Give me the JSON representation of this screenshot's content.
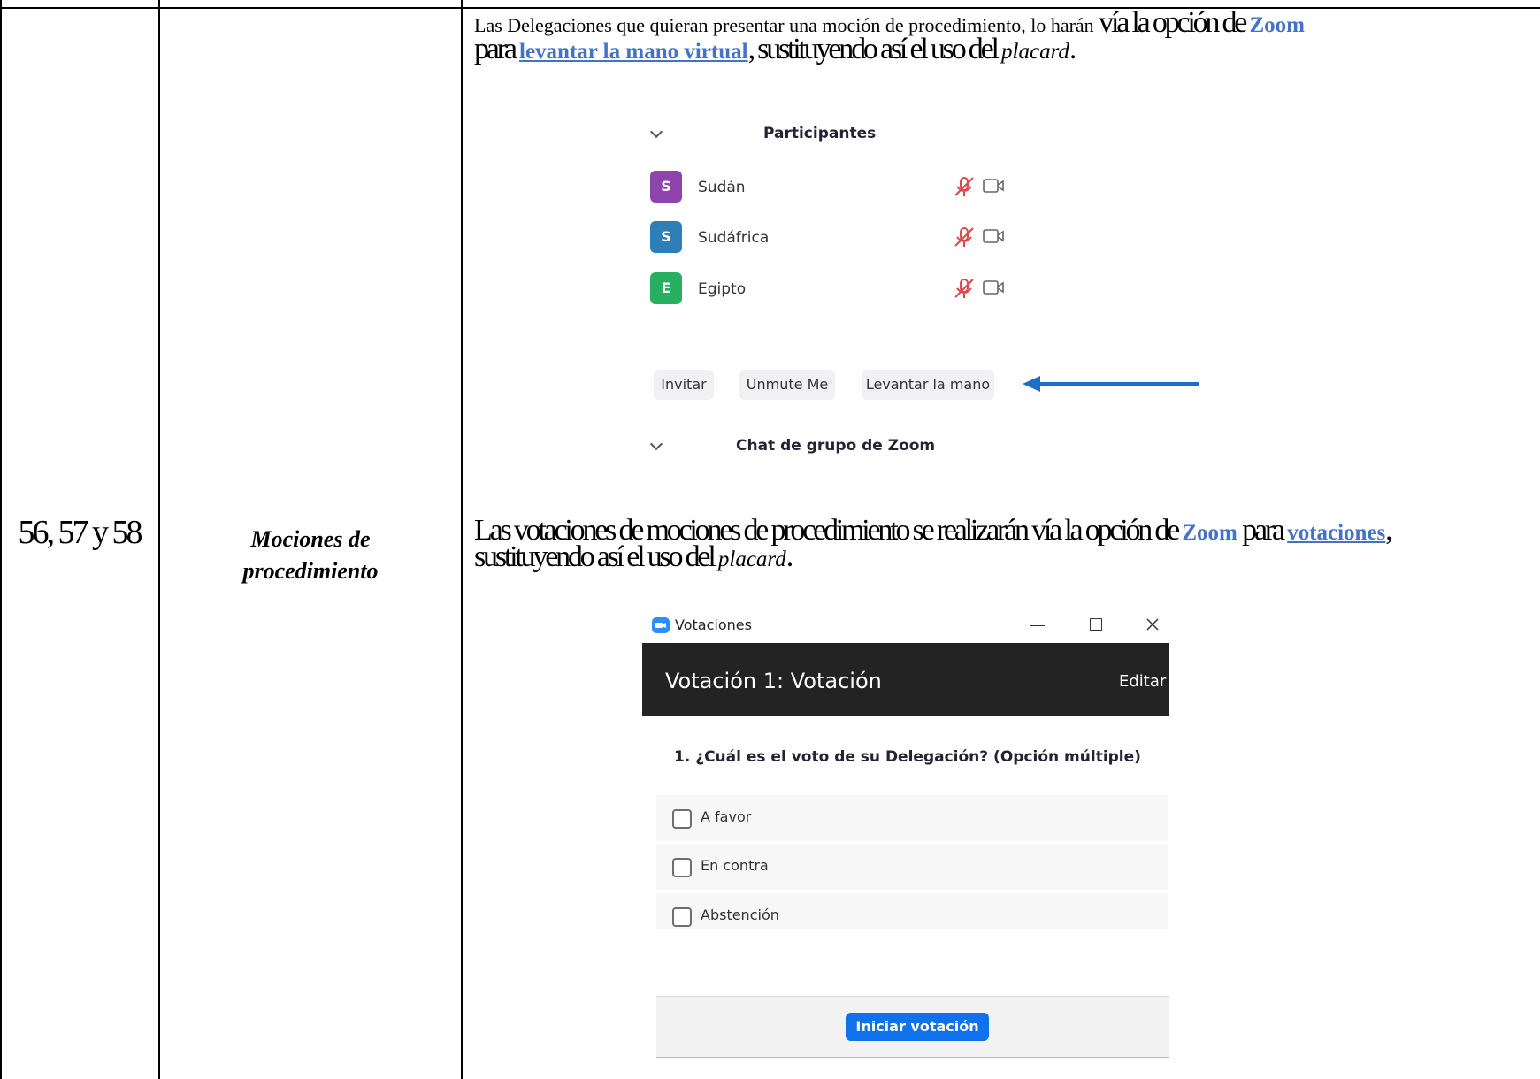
{
  "row": {
    "articles": "56, 57 y 58",
    "topic_line1": "Mociones de",
    "topic_line2": "procedimiento"
  },
  "para1": {
    "part1": "Las Delegaciones que quieran presentar una moción de procedimiento, lo harán ",
    "part2": "vía la opción de ",
    "zoom": "Zoom",
    "part3": "para ",
    "link": "levantar la mano virtual",
    "part4": ", sustituyendo así el uso del ",
    "italic": "placard",
    "end": "."
  },
  "participants_panel": {
    "title": "Participantes",
    "participants": [
      {
        "initial": "S",
        "name": "Sudán",
        "color": "#8e44ad"
      },
      {
        "initial": "S",
        "name": "Sudáfrica",
        "color": "#2d7fb8"
      },
      {
        "initial": "E",
        "name": "Egipto",
        "color": "#27ae60"
      }
    ],
    "buttons": {
      "invite": "Invitar",
      "unmute": "Unmute Me",
      "raise_hand": "Levantar la mano"
    },
    "chat_title": "Chat de grupo de Zoom",
    "icons": {
      "muted_mic": "mic-off-icon",
      "camera": "video-camera-icon",
      "arrow": "arrow-left-icon"
    },
    "accent": "#1e6ec8",
    "muted_color": "#e0474c"
  },
  "para2": {
    "part1": "Las votaciones de mociones de procedimiento se realizarán vía la opción de ",
    "zoom": "Zoom",
    "part2": " para ",
    "link": "votaciones",
    "part3": ",",
    "part4": "sustituyendo así el uso del ",
    "italic": "placard",
    "end": "."
  },
  "poll_window": {
    "window_title": "Votaciones",
    "poll_title": "Votación 1: Votación",
    "edit": "Editar",
    "question": "1. ¿Cuál es el voto de su Delegación? (Opción múltiple)",
    "options": [
      "A favor",
      "En contra",
      "Abstención"
    ],
    "start_button": "Iniciar votación",
    "icons": {
      "app": "zoom-app-icon",
      "minimize": "minimize-icon",
      "maximize": "maximize-icon",
      "close": "close-icon"
    },
    "button_color": "#0e72ed"
  }
}
